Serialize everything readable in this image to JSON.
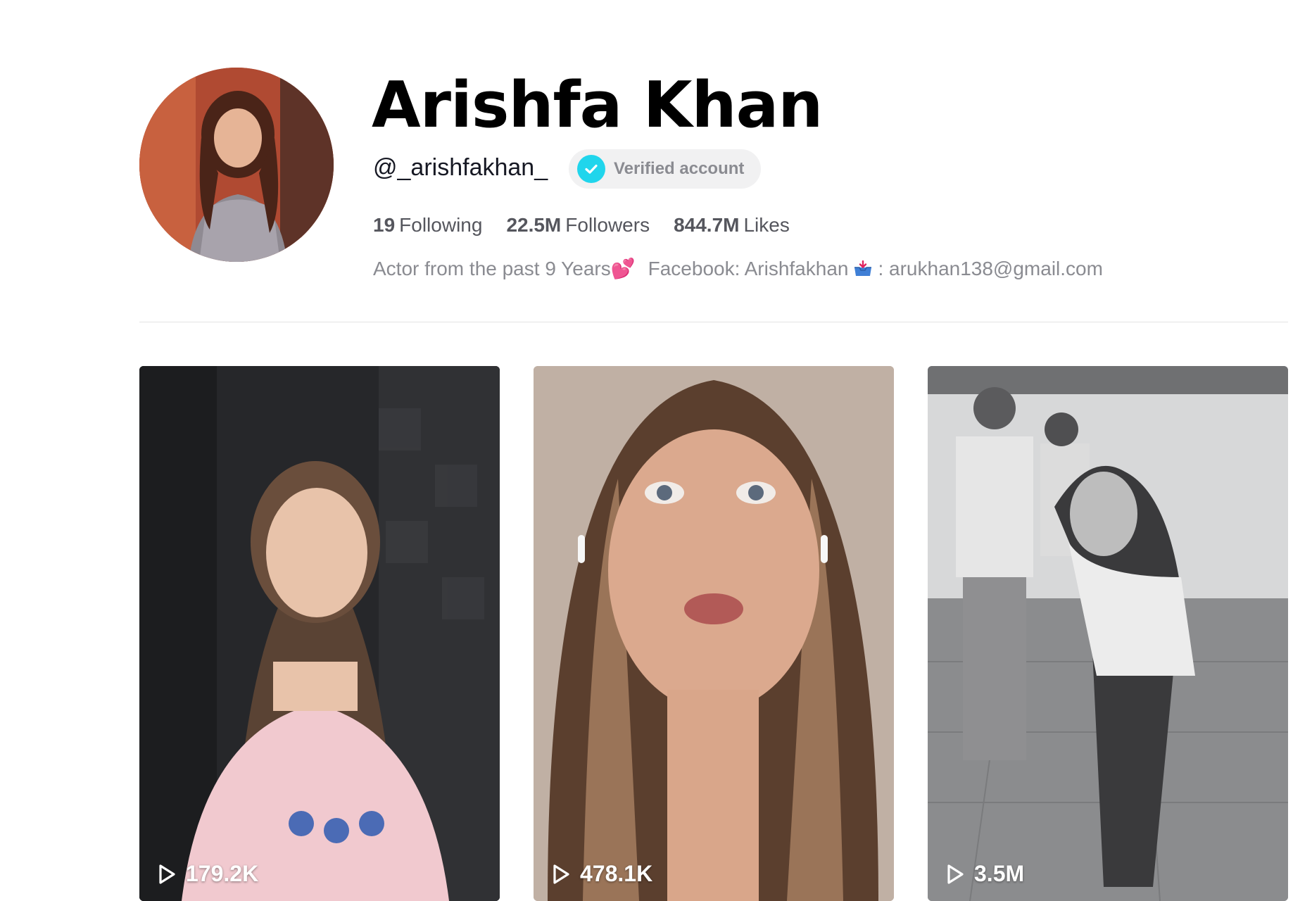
{
  "profile": {
    "display_name": "Arishfa Khan",
    "username": "@_arishfakhan_",
    "verified_label": "Verified account",
    "stats": [
      {
        "value": "19",
        "label": "Following"
      },
      {
        "value": "22.5M",
        "label": "Followers"
      },
      {
        "value": "844.7M",
        "label": "Likes"
      }
    ],
    "bio": {
      "part1": "Actor from the past 9 Years",
      "heart_emoji": "💕",
      "part2": "Facebook: Arishfakhan",
      "part3": ": arukhan138@gmail.com"
    }
  },
  "videos": [
    {
      "views": "179.2K",
      "icon": "play-icon"
    },
    {
      "views": "478.1K",
      "icon": "play-icon"
    },
    {
      "views": "3.5M",
      "icon": "play-icon"
    }
  ],
  "colors": {
    "verified_badge": "#20d5ec",
    "stat_text": "#55565d",
    "bio_text": "#8a8b91",
    "divider": "#e3e3e4"
  }
}
